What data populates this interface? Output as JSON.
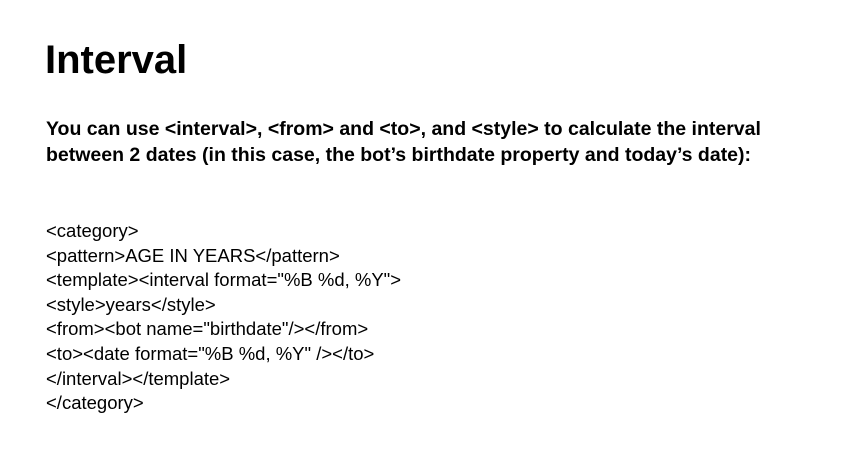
{
  "slide": {
    "title": "Interval",
    "intro": "You can use <interval>, <from> and <to>, and <style> to calculate the interval between 2 dates (in this case, the bot’s birthdate property and today’s date):",
    "code_lines": [
      "<category>",
      "<pattern>AGE IN YEARS</pattern>",
      "<template><interval format=\"%B %d, %Y\">",
      "<style>years</style>",
      "<from><bot name=\"birthdate\"/></from>",
      "<to><date format=\"%B %d, %Y\" /></to>",
      "</interval></template>",
      "</category>"
    ]
  }
}
